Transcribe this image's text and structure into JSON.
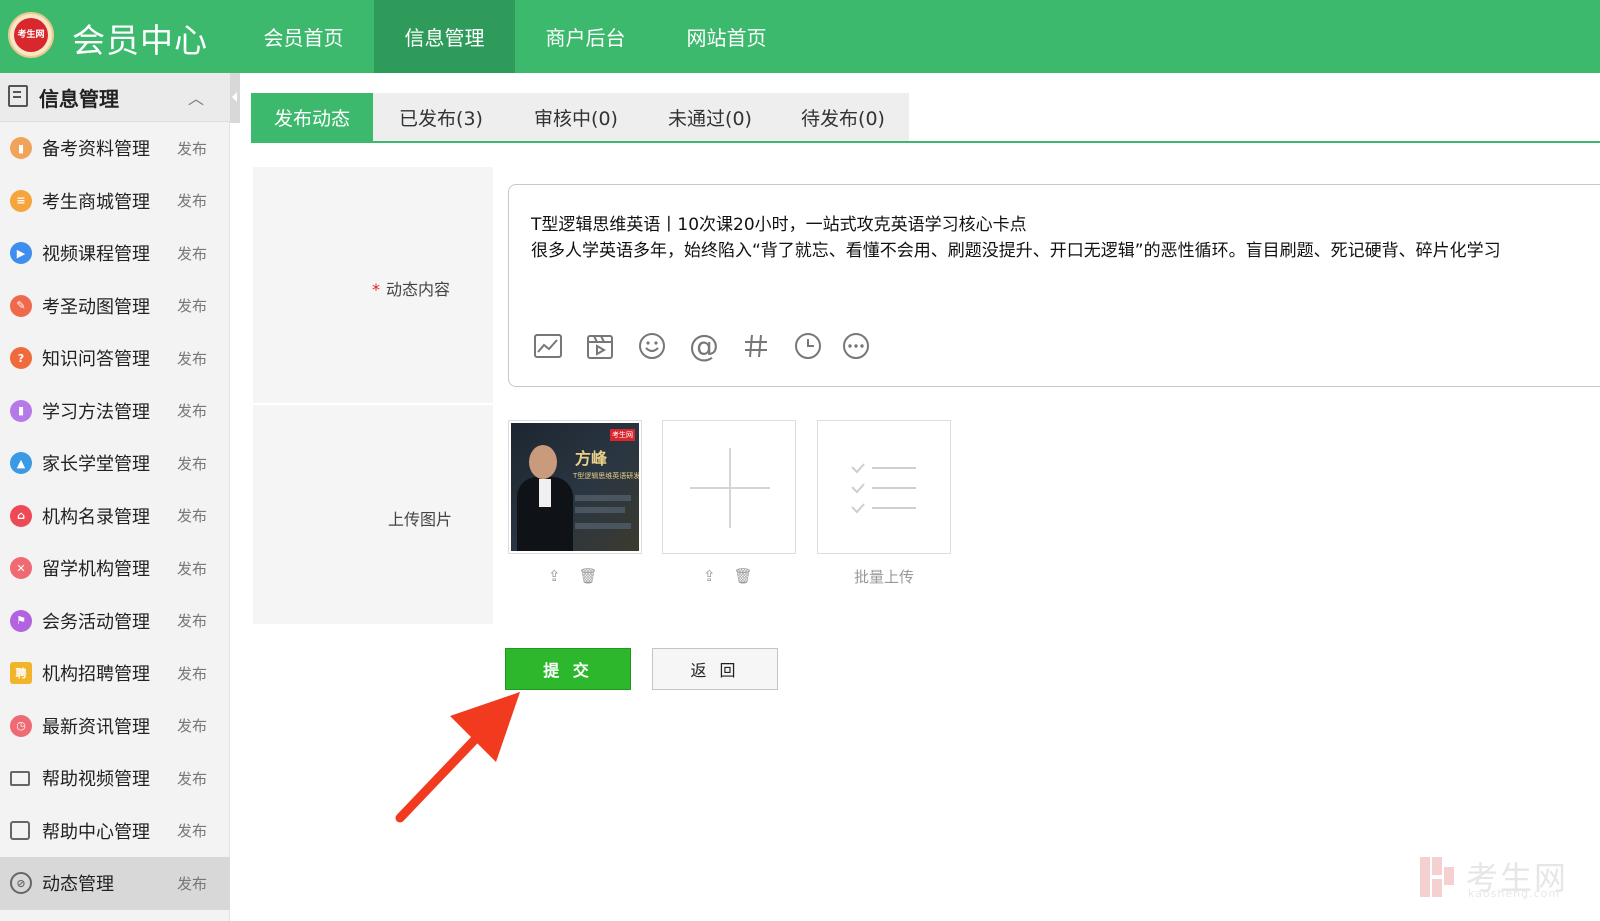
{
  "header": {
    "logo_text": "考生网",
    "title": "会员中心",
    "nav": [
      {
        "label": "会员首页"
      },
      {
        "label": "信息管理"
      },
      {
        "label": "商户后台"
      },
      {
        "label": "网站首页"
      }
    ]
  },
  "sidebar": {
    "header_title": "信息管理",
    "items": [
      {
        "label": "备考资料管理",
        "action": "发布",
        "icon": "folder-icon",
        "color": "#f0a45a"
      },
      {
        "label": "考生商城管理",
        "action": "发布",
        "icon": "cart-icon",
        "color": "#f5a53b"
      },
      {
        "label": "视频课程管理",
        "action": "发布",
        "icon": "video-icon",
        "color": "#3e8ef0"
      },
      {
        "label": "考圣动图管理",
        "action": "发布",
        "icon": "pen-icon",
        "color": "#ee6a4a"
      },
      {
        "label": "知识问答管理",
        "action": "发布",
        "icon": "qa-icon",
        "color": "#f06a3e"
      },
      {
        "label": "学习方法管理",
        "action": "发布",
        "icon": "chart-icon",
        "color": "#b57ae8"
      },
      {
        "label": "家长学堂管理",
        "action": "发布",
        "icon": "graduation-cap-icon",
        "color": "#3a9ae6"
      },
      {
        "label": "机构名录管理",
        "action": "发布",
        "icon": "home-icon",
        "color": "#ee4a55"
      },
      {
        "label": "留学机构管理",
        "action": "发布",
        "icon": "plane-icon",
        "color": "#ef6a72"
      },
      {
        "label": "会务活动管理",
        "action": "发布",
        "icon": "flag-icon",
        "color": "#b463e0"
      },
      {
        "label": "机构招聘管理",
        "action": "发布",
        "icon": "recruit-icon",
        "color": "#f2b52a"
      },
      {
        "label": "最新资讯管理",
        "action": "发布",
        "icon": "clock-icon",
        "color": "#ee6b74"
      },
      {
        "label": "帮助视频管理",
        "action": "发布",
        "icon": "camera-icon",
        "color": "#666666"
      },
      {
        "label": "帮助中心管理",
        "action": "发布",
        "icon": "calendar-icon",
        "color": "#666666"
      },
      {
        "label": "动态管理",
        "action": "发布",
        "icon": "compass-icon",
        "color": "#666666"
      }
    ]
  },
  "tabs": [
    {
      "label": "发布动态"
    },
    {
      "label": "已发布(3)"
    },
    {
      "label": "审核中(0)"
    },
    {
      "label": "未通过(0)"
    },
    {
      "label": "待发布(0)"
    }
  ],
  "form": {
    "content_label": "动态内容",
    "required_mark": "*",
    "content_lines": [
      "T型逻辑思维英语丨10次课20小时，一站式攻克英语学习核心卡点",
      "很多人学英语多年，始终陷入“背了就忘、看懂不会用、刷题没提升、开口无逻辑”的恶性循环。盲目刷题、死记硬背、碎片化学习"
    ],
    "upload_label": "上传图片",
    "batch_upload_label": "批量上传",
    "image": {
      "brand": "考生网",
      "title": "方峰",
      "subtitle": "T型逻辑思维英语研发人"
    },
    "submit_label": "提 交",
    "back_label": "返 回"
  },
  "watermark": {
    "text": "考生网",
    "sub": "kaosheng.com"
  },
  "colors": {
    "brand_green": "#3cb96d",
    "nav_active": "#2e9b5a",
    "submit_green": "#2db72d",
    "arrow_red": "#f23a1f"
  }
}
